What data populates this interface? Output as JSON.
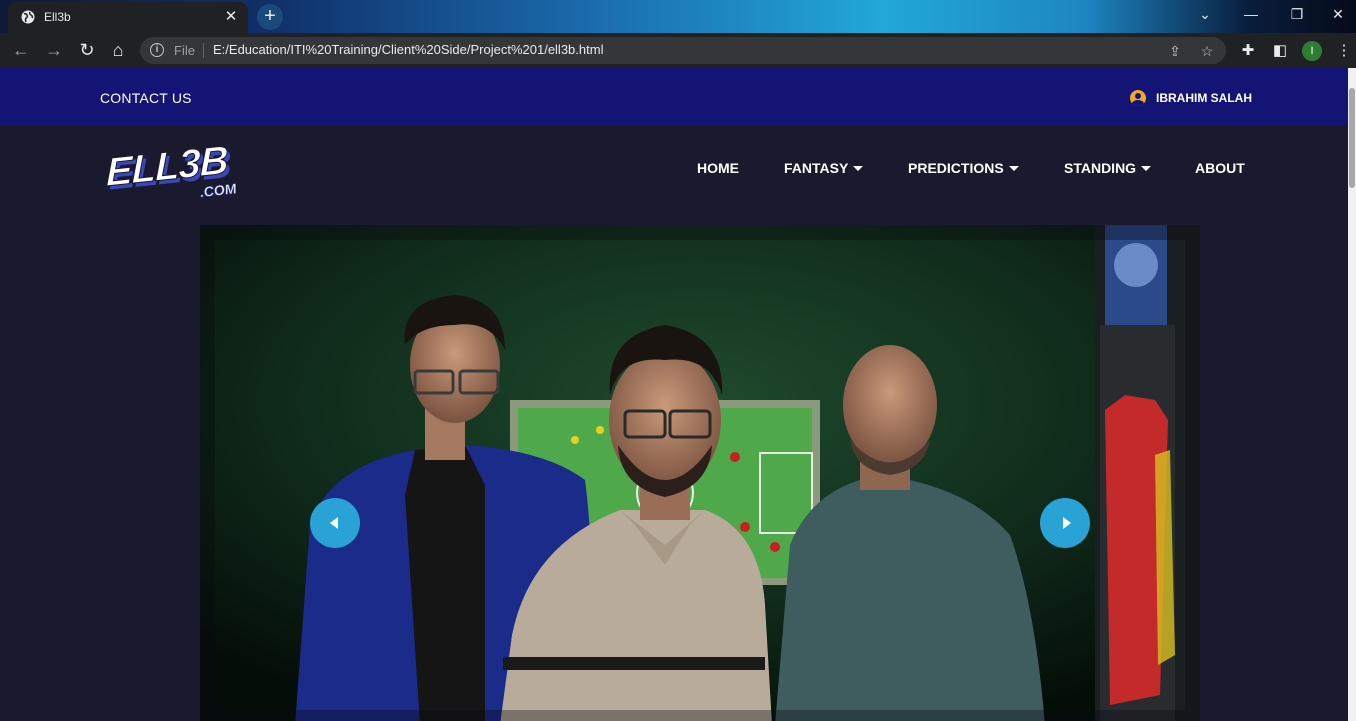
{
  "browser": {
    "tab_title": "Ell3b",
    "tab_close": "✕",
    "new_tab": "+",
    "scheme": "File",
    "url": "E:/Education/ITI%20Training/Client%20Side/Project%201/ell3b.html",
    "profile_initial": "I"
  },
  "site": {
    "contact_label": "CONTACT US",
    "user_name": "IBRAHIM SALAH",
    "logo_text": "ELL3B",
    "logo_sub": ".COM",
    "nav": [
      {
        "label": "HOME",
        "dropdown": false
      },
      {
        "label": "FANTASY",
        "dropdown": true
      },
      {
        "label": "PREDICTIONS",
        "dropdown": true
      },
      {
        "label": "STANDING",
        "dropdown": true
      },
      {
        "label": "ABOUT",
        "dropdown": false
      }
    ],
    "colors": {
      "topbar": "#131473",
      "page_bg": "#1a1a2e",
      "carousel_button": "#29a3d6",
      "user_icon": "#f4a623"
    }
  }
}
